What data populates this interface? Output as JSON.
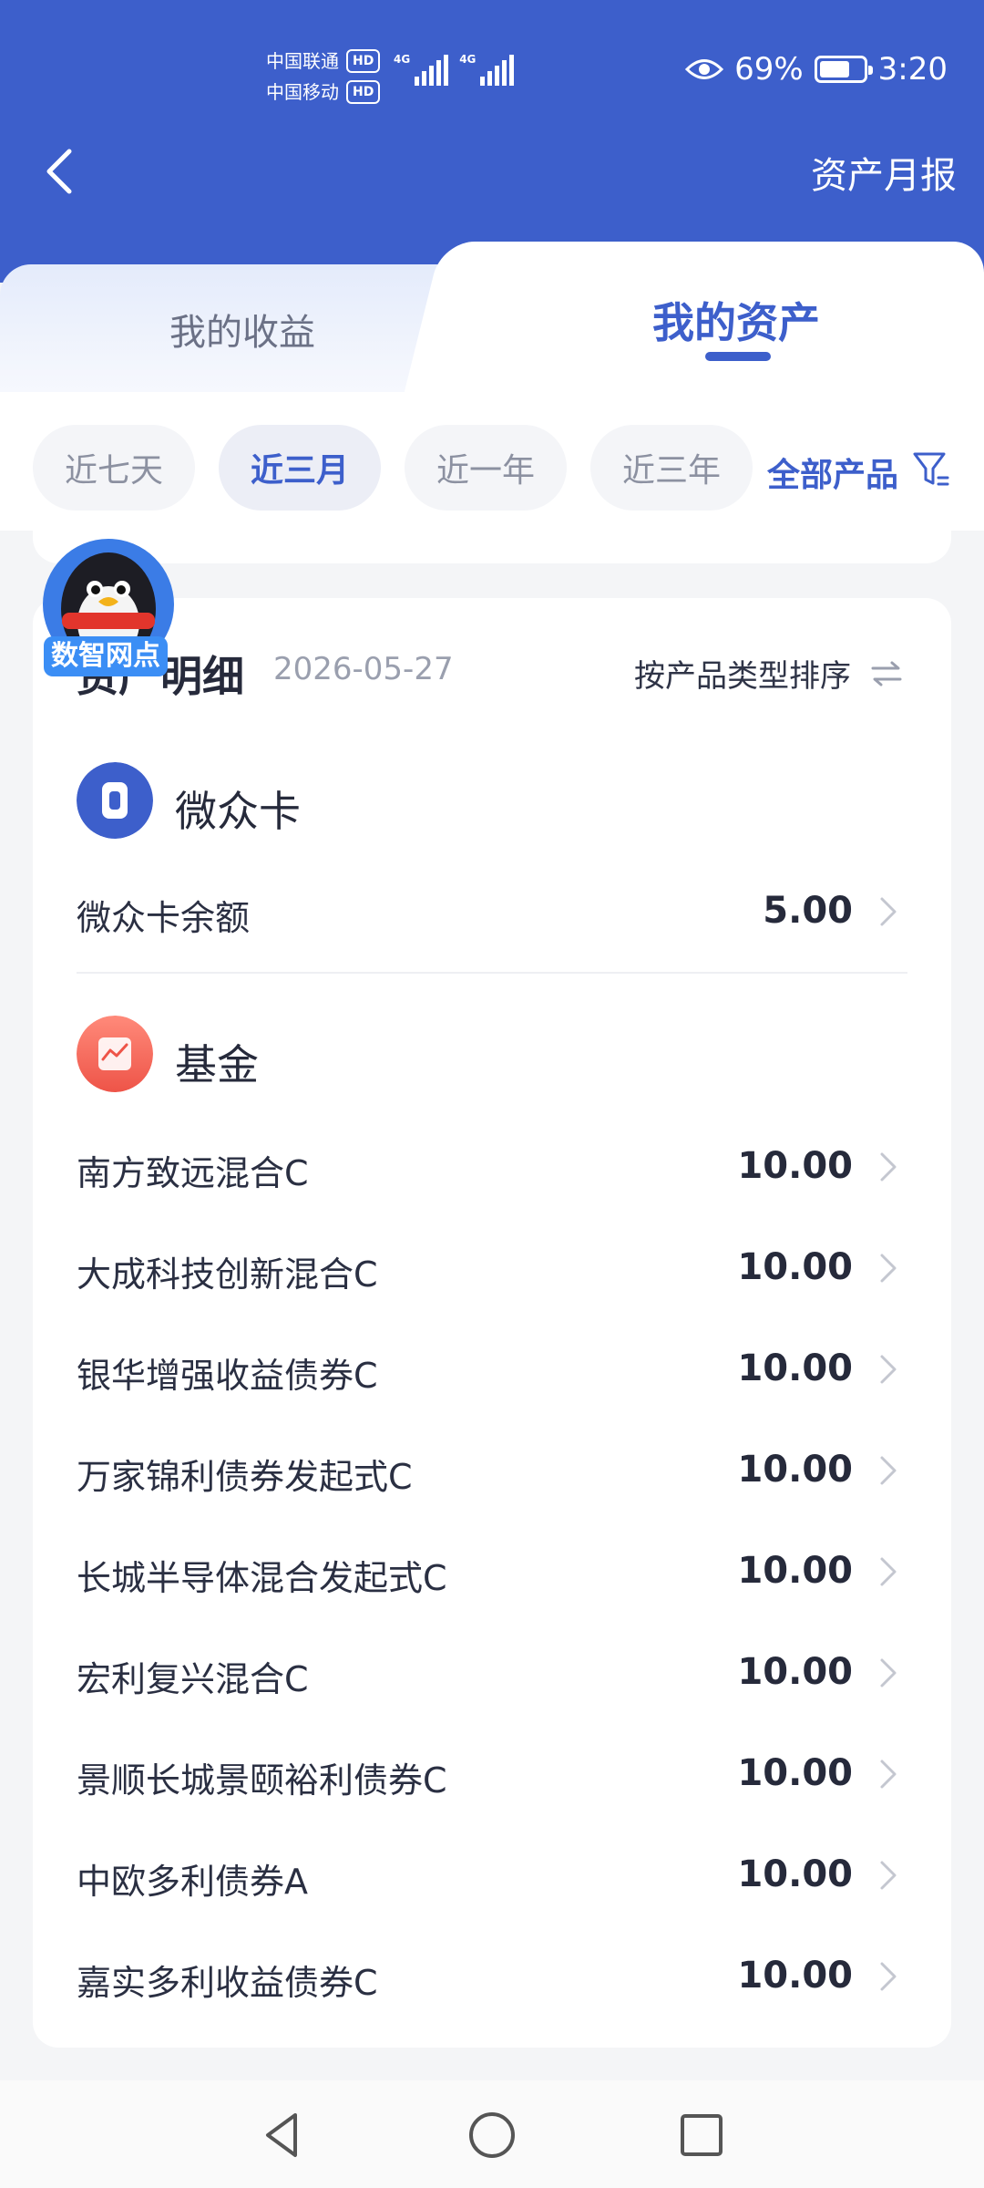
{
  "status_bar": {
    "carrier1": "中国联通",
    "carrier2": "中国移动",
    "hd": "HD",
    "network": "4G",
    "battery_percent": "69%",
    "battery_level": 0.69,
    "time": "3:20"
  },
  "header": {
    "report_link": "资产月报"
  },
  "tabs": {
    "left": "我的收益",
    "right": "我的资产",
    "active": "我的资产"
  },
  "filters": {
    "chips": [
      "近七天",
      "近三月",
      "近一年",
      "近三年"
    ],
    "active": "近三月",
    "all_products": "全部产品"
  },
  "mascot": {
    "badge": "数智网点"
  },
  "details": {
    "title": "资产明细",
    "date": "2026-05-27",
    "sort_label": "按产品类型排序"
  },
  "categories": [
    {
      "name": "微众卡",
      "icon": "card-icon",
      "color": "#3d5fcb",
      "items": [
        {
          "name": "微众卡余额",
          "value": "5.00"
        }
      ]
    },
    {
      "name": "基金",
      "icon": "fund-chart-icon",
      "color": "#f26b5e",
      "items": [
        {
          "name": "南方致远混合C",
          "value": "10.00"
        },
        {
          "name": "大成科技创新混合C",
          "value": "10.00"
        },
        {
          "name": "银华增强收益债券C",
          "value": "10.00"
        },
        {
          "name": "万家锦利债券发起式C",
          "value": "10.00"
        },
        {
          "name": "长城半导体混合发起式C",
          "value": "10.00"
        },
        {
          "name": "宏利复兴混合C",
          "value": "10.00"
        },
        {
          "name": "景顺长城景颐裕利债券C",
          "value": "10.00"
        },
        {
          "name": "中欧多利债券A",
          "value": "10.00"
        },
        {
          "name": "嘉实多利收益债券C",
          "value": "10.00"
        }
      ]
    }
  ],
  "accent_color": "#3d5fcb"
}
